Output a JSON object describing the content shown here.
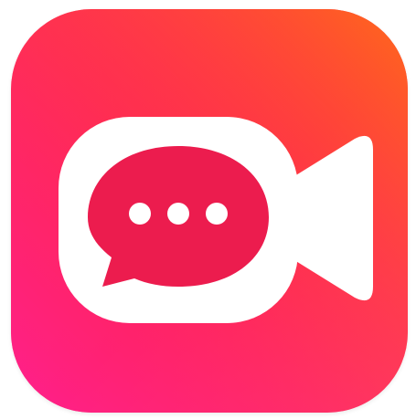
{
  "app_icon": {
    "icon": "video-chat-icon",
    "colors": {
      "gradient_top_left": "#ff2d55",
      "gradient_top_right": "#ff6a1a",
      "gradient_bottom_left": "#ff1f7a",
      "gradient_bottom_right": "#ff3a6a",
      "glyph": "#ffffff",
      "bubble_fill": "#ec1c4e"
    },
    "camera_icon": "video-camera-icon",
    "bubble_icon": "chat-bubble-icon",
    "dots_icon": "ellipsis-icon"
  }
}
